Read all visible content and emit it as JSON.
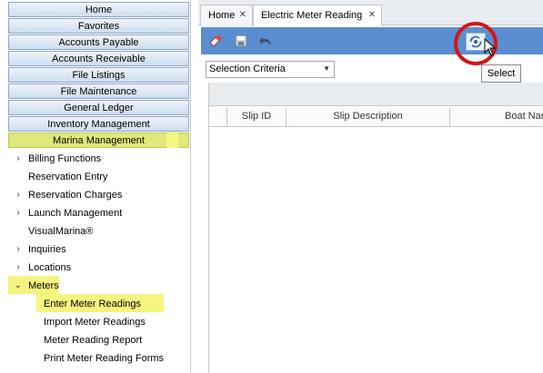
{
  "sidebar": {
    "modules": [
      "Home",
      "Favorites",
      "Accounts Payable",
      "Accounts Receivable",
      "File Listings",
      "File Maintenance",
      "General Ledger",
      "Inventory Management",
      "Marina Management"
    ],
    "tree": [
      {
        "label": "Billing Functions",
        "expander": "chevron-right-icon"
      },
      {
        "label": "Reservation Entry",
        "expander": ""
      },
      {
        "label": "Reservation Charges",
        "expander": "chevron-right-icon"
      },
      {
        "label": "Launch Management",
        "expander": "chevron-right-icon"
      },
      {
        "label": "VisualMarina®",
        "expander": ""
      },
      {
        "label": "Inquiries",
        "expander": "chevron-right-icon"
      },
      {
        "label": "Locations",
        "expander": "chevron-right-icon"
      },
      {
        "label": "Meters",
        "expander": "chevron-down-icon"
      }
    ],
    "meter_children": [
      "Enter Meter Readings",
      "Import Meter Readings",
      "Meter Reading Report",
      "Print Meter Reading Forms"
    ]
  },
  "tabs": {
    "home": "Home",
    "active": "Electric Meter Reading",
    "close": "✕"
  },
  "toolbar": {
    "select_tooltip": "Select"
  },
  "criteria": {
    "selected": "Selection Criteria"
  },
  "grid": {
    "columns": [
      "Slip ID",
      "Slip Description",
      "Boat Nar"
    ]
  },
  "colors": {
    "toolbar": "#5a8ed0",
    "highlight": "#f4f580",
    "active_module": "#dfe87a",
    "annotation": "#d11616"
  }
}
